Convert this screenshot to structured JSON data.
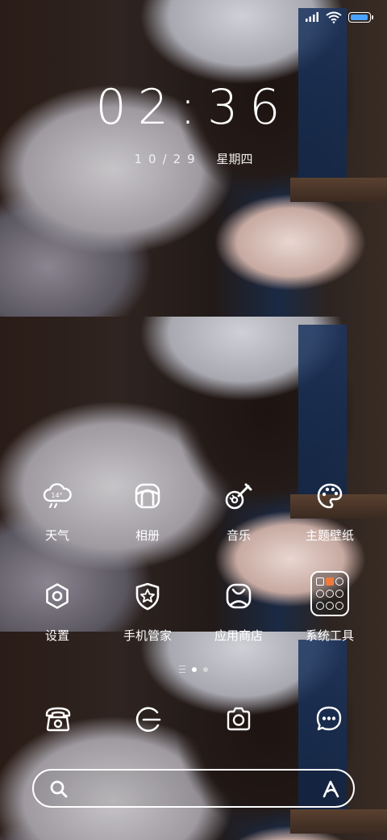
{
  "status": {
    "battery_level": 1.0,
    "battery_color": "#4aa3ff"
  },
  "lockscreen": {
    "time": "02:36",
    "date": "10/29",
    "weekday": "星期四"
  },
  "apps": [
    {
      "label": "天气",
      "icon": "weather-icon",
      "badge": "14°"
    },
    {
      "label": "相册",
      "icon": "gallery-icon"
    },
    {
      "label": "音乐",
      "icon": "music-icon"
    },
    {
      "label": "主题壁纸",
      "icon": "themes-icon"
    },
    {
      "label": "设置",
      "icon": "settings-icon"
    },
    {
      "label": "手机管家",
      "icon": "security-icon"
    },
    {
      "label": "应用商店",
      "icon": "app-store-icon"
    },
    {
      "label": "系统工具",
      "icon": "system-tools-folder-icon"
    }
  ],
  "pager": {
    "pages": 2,
    "current": 1
  },
  "dock": [
    "phone-icon",
    "browser-icon",
    "camera-icon",
    "messages-icon"
  ],
  "search": {
    "placeholder": "",
    "left_icon": "search-icon",
    "right_icon": "assistant-icon"
  }
}
